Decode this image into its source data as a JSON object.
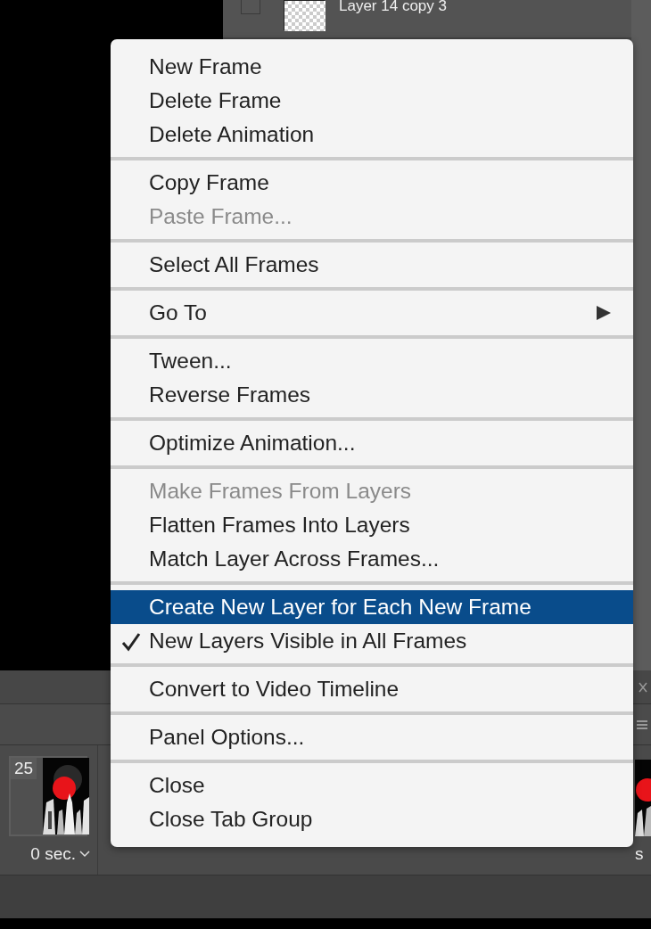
{
  "layers_panel": {
    "layer": {
      "name": "Layer 14 copy 3",
      "visible": false
    }
  },
  "timeline": {
    "frames": [
      {
        "number": "25",
        "delay": "0 sec.",
        "selected": false
      }
    ],
    "partial_frame_text": "s"
  },
  "context_menu": {
    "groups": [
      {
        "items": [
          {
            "label": "New Frame",
            "disabled": false,
            "checked": false,
            "selected": false
          },
          {
            "label": "Delete Frame",
            "disabled": false,
            "checked": false,
            "selected": false
          },
          {
            "label": "Delete Animation",
            "disabled": false,
            "checked": false,
            "selected": false
          }
        ]
      },
      {
        "items": [
          {
            "label": "Copy Frame",
            "disabled": false,
            "checked": false,
            "selected": false
          },
          {
            "label": "Paste Frame...",
            "disabled": true,
            "checked": false,
            "selected": false
          }
        ]
      },
      {
        "items": [
          {
            "label": "Select All Frames",
            "disabled": false,
            "checked": false,
            "selected": false
          }
        ]
      },
      {
        "items": [
          {
            "label": "Go To",
            "disabled": false,
            "checked": false,
            "selected": false,
            "submenu": true
          }
        ]
      },
      {
        "items": [
          {
            "label": "Tween...",
            "disabled": false,
            "checked": false,
            "selected": false
          },
          {
            "label": "Reverse Frames",
            "disabled": false,
            "checked": false,
            "selected": false
          }
        ]
      },
      {
        "items": [
          {
            "label": "Optimize Animation...",
            "disabled": false,
            "checked": false,
            "selected": false
          }
        ]
      },
      {
        "items": [
          {
            "label": "Make Frames From Layers",
            "disabled": true,
            "checked": false,
            "selected": false
          },
          {
            "label": "Flatten Frames Into Layers",
            "disabled": false,
            "checked": false,
            "selected": false
          },
          {
            "label": "Match Layer Across Frames...",
            "disabled": false,
            "checked": false,
            "selected": false
          }
        ]
      },
      {
        "items": [
          {
            "label": "Create New Layer for Each New Frame",
            "disabled": false,
            "checked": false,
            "selected": true
          },
          {
            "label": "New Layers Visible in All Frames",
            "disabled": false,
            "checked": true,
            "selected": false
          }
        ]
      },
      {
        "items": [
          {
            "label": "Convert to Video Timeline",
            "disabled": false,
            "checked": false,
            "selected": false
          }
        ]
      },
      {
        "items": [
          {
            "label": "Panel Options...",
            "disabled": false,
            "checked": false,
            "selected": false
          }
        ]
      },
      {
        "items": [
          {
            "label": "Close",
            "disabled": false,
            "checked": false,
            "selected": false
          },
          {
            "label": "Close Tab Group",
            "disabled": false,
            "checked": false,
            "selected": false
          }
        ]
      }
    ]
  }
}
